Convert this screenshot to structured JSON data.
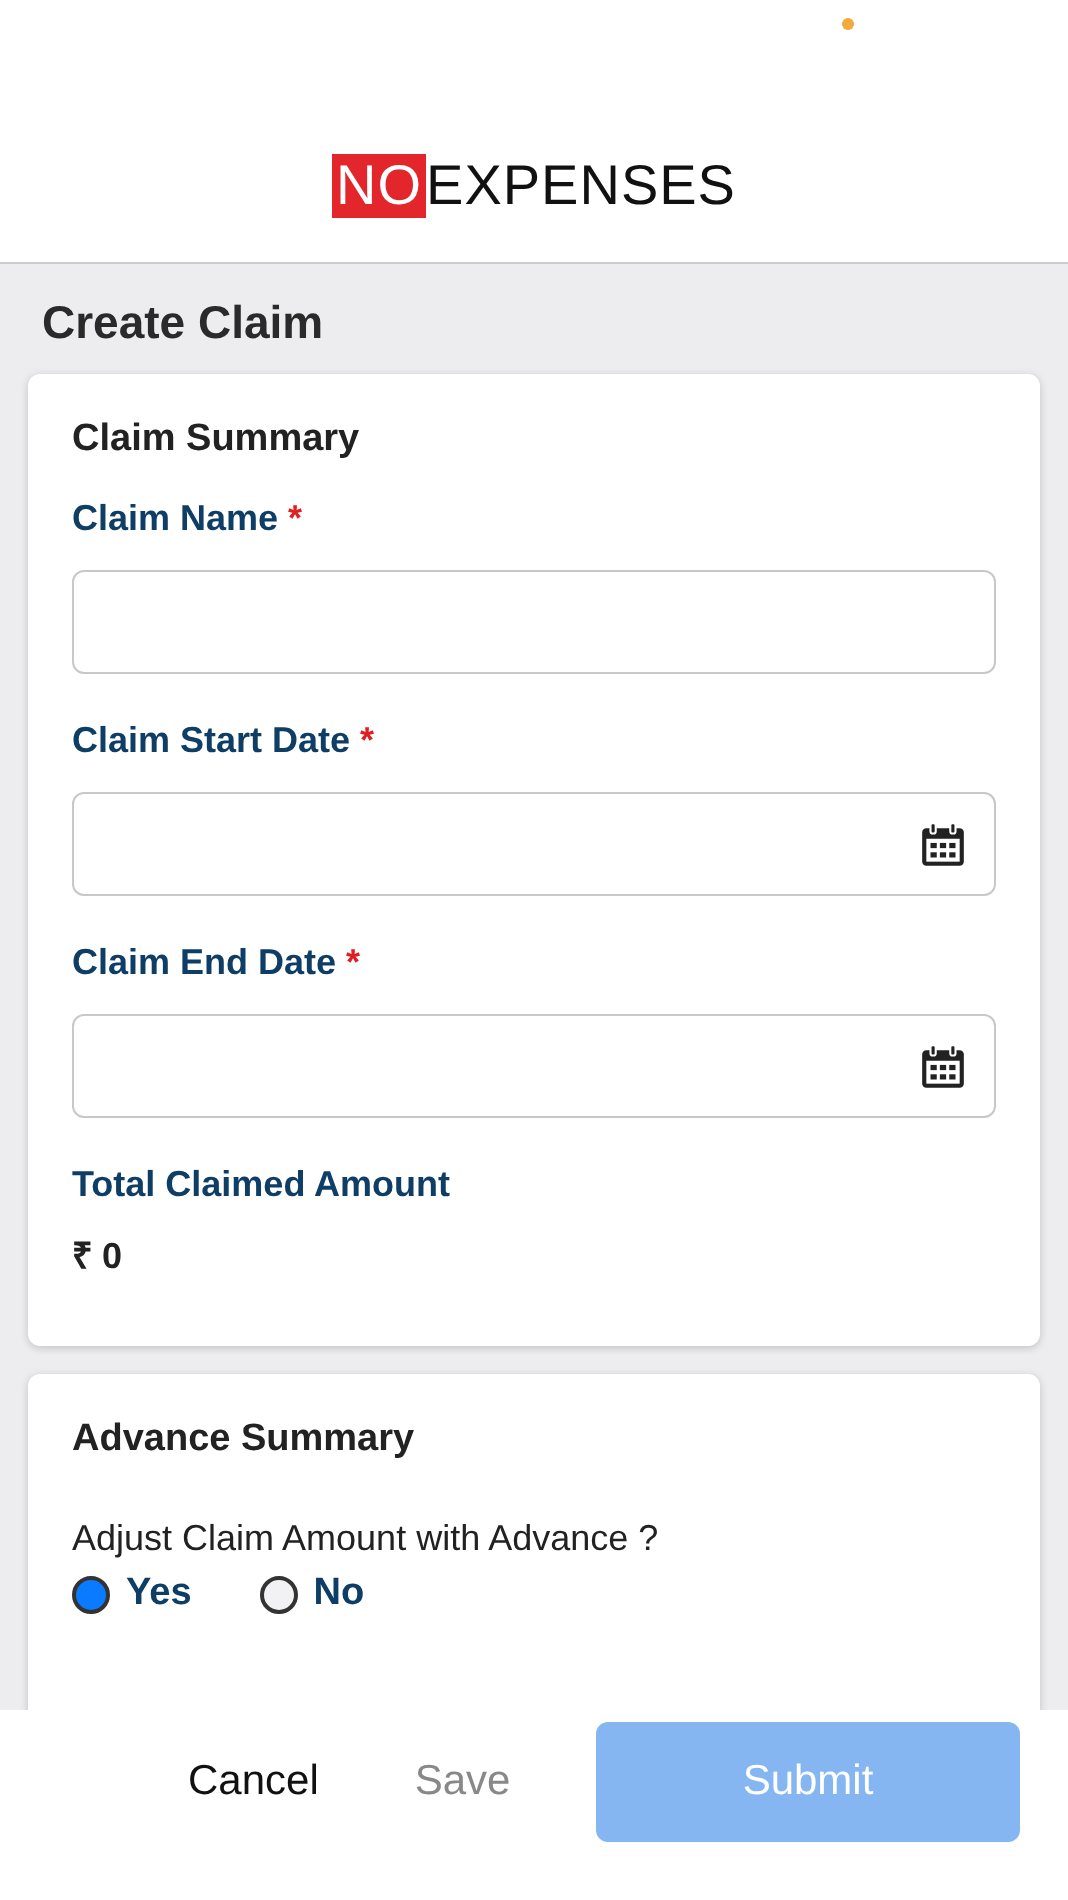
{
  "logo": {
    "highlight": "NO",
    "rest": "EXPENSES"
  },
  "page_title": "Create Claim",
  "claim_summary": {
    "title": "Claim Summary",
    "fields": [
      {
        "label": "Claim Name",
        "required_mark": "*",
        "kind": "text"
      },
      {
        "label": "Claim Start Date",
        "required_mark": "*",
        "kind": "date"
      },
      {
        "label": "Claim End Date",
        "required_mark": "*",
        "kind": "date"
      }
    ],
    "total_label": "Total Claimed Amount",
    "total_value": "₹ 0"
  },
  "advance_summary": {
    "title": "Advance Summary",
    "question": "Adjust Claim Amount with Advance ?",
    "options": [
      {
        "label": "Yes",
        "selected": true
      },
      {
        "label": "No",
        "selected": false
      }
    ]
  },
  "buttons": [
    {
      "label": "Cancel",
      "kind": "text",
      "disabled": false
    },
    {
      "label": "Save",
      "kind": "text",
      "disabled": true
    },
    {
      "label": "Submit",
      "kind": "primary",
      "disabled": true
    }
  ]
}
